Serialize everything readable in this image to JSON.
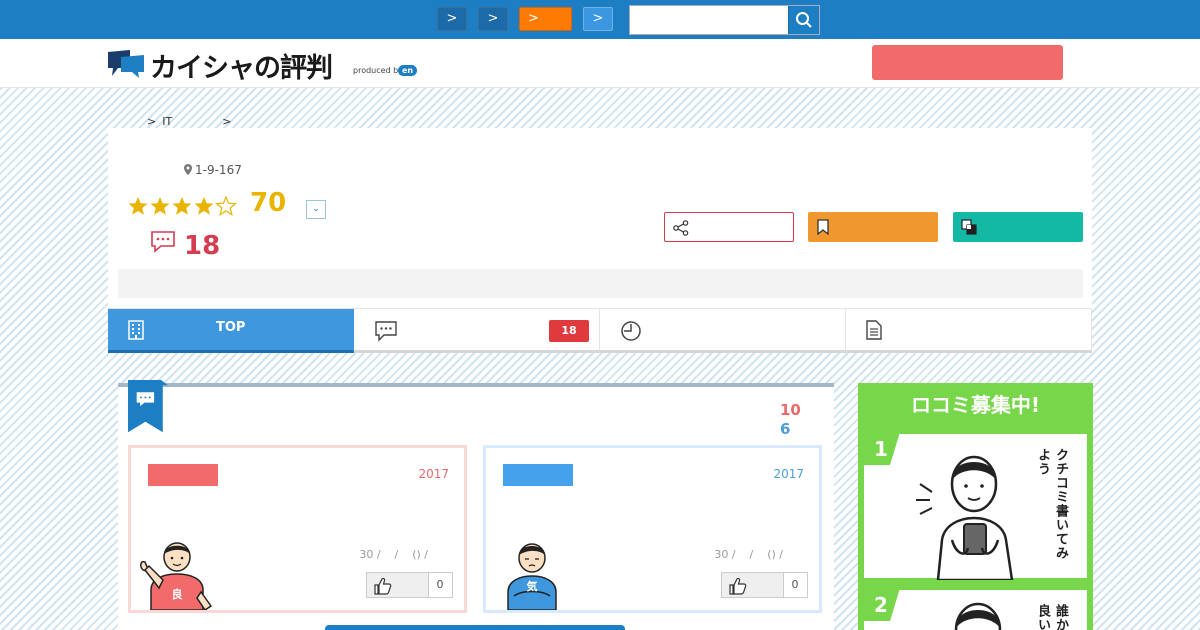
{
  "topbar": {
    "buttons": [
      ">",
      ">",
      ">",
      ">"
    ],
    "search_placeholder": ""
  },
  "header": {
    "logo_text": "カイシャの評判",
    "logo_sub": "produced by",
    "logo_badge": "en"
  },
  "breadcrumb": [
    ">",
    "IT",
    ">"
  ],
  "company": {
    "address": "1-9-167",
    "rating": "70",
    "stars": 4,
    "review_count": "18"
  },
  "tabs": [
    {
      "label": "TOP",
      "icon": "building-icon",
      "active": true
    },
    {
      "label": "",
      "icon": "speech-bubble-icon",
      "badge": "18"
    },
    {
      "label": "",
      "icon": "clock-icon"
    },
    {
      "label": "",
      "icon": "document-icon"
    }
  ],
  "reviews": {
    "good_count": "10",
    "bad_count": "6",
    "items": [
      {
        "type": "good",
        "year": "2017",
        "meta": "30 /    /    () /",
        "likes": "0",
        "badge_char": "良"
      },
      {
        "type": "bad",
        "year": "2017",
        "meta": "30 /    /    () /",
        "likes": "0",
        "badge_char": "気"
      }
    ]
  },
  "sidebar": {
    "title": "ロコミ募集中!",
    "comic1_step": "1",
    "comic1_text": "クチコミ書いてみよう",
    "comic2_step": "2",
    "comic2_text": "誰か良い"
  },
  "colors": {
    "topbar": "#1d7ec4",
    "accent_red": "#f26b6b",
    "star_yellow": "#e9b400",
    "count_red": "#d43c50",
    "follow_orange": "#f0982e",
    "compare_teal": "#14b9a6",
    "sidebar_green": "#78d64b"
  }
}
